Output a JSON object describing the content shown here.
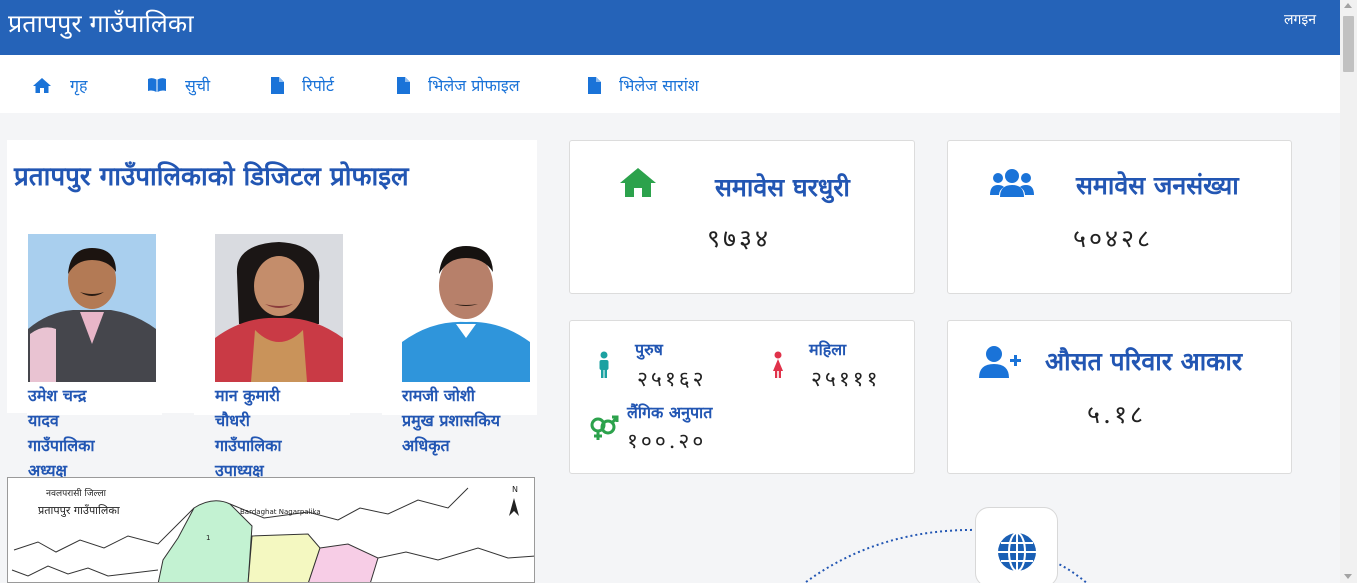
{
  "header": {
    "brand": "प्रतापपुर गाउँपालिका",
    "login_label": "लगइन"
  },
  "nav": [
    {
      "label": "गृह",
      "icon": "home-icon"
    },
    {
      "label": "सुची",
      "icon": "book-icon"
    },
    {
      "label": "रिपोर्ट",
      "icon": "file-icon"
    },
    {
      "label": "भिलेज प्रोफाइल",
      "icon": "file-icon"
    },
    {
      "label": "भिलेज सारांश",
      "icon": "file-icon"
    }
  ],
  "profile": {
    "title": "प्रतापपुर गाउँपालिकाको डिजिटल प्रोफाइल",
    "people": [
      {
        "name_lines": [
          "उमेश चन्द्र",
          "यादव"
        ],
        "role_lines": [
          "गाउँपालिका",
          "अध्यक्ष"
        ]
      },
      {
        "name_lines": [
          "मान कुमारी",
          "चौधरी"
        ],
        "role_lines": [
          "गाउँपालिका",
          "उपाध्यक्ष"
        ]
      },
      {
        "name_lines": [
          "रामजी जोशी"
        ],
        "role_lines": [
          "प्रमुख प्रशासकिय",
          "अधिकृत"
        ]
      }
    ],
    "map": {
      "district_label": "नवलपरासी जिल्ला",
      "palika_label": "प्रतापपुर गाउँपालिका",
      "neighbor_label": "Bardaghat Nagarpalika",
      "north_label": "N",
      "ward_label": "1"
    }
  },
  "stats": {
    "households": {
      "title": "समावेस घरधुरी",
      "value": "९७३४",
      "icon": "home-icon"
    },
    "population": {
      "title": "समावेस जनसंख्या",
      "value": "५०४२८",
      "icon": "users-icon"
    },
    "gender": {
      "male_label": "पुरुष",
      "male_value": "२५१६२",
      "female_label": "महिला",
      "female_value": "२५१११",
      "ratio_label": "लैंगिक अनुपात",
      "ratio_value": "१००.२०"
    },
    "family": {
      "title": "औसत परिवार आकार",
      "value": "५.१८",
      "icon": "user-plus-icon"
    }
  },
  "colors": {
    "header": "#2563b8",
    "nav_link": "#1a73d8",
    "heading": "#2256b3",
    "home_green": "#2ca24c",
    "male_teal": "#1ba1a1",
    "female_red": "#e0324a",
    "ratio_green": "#2ca24c"
  }
}
